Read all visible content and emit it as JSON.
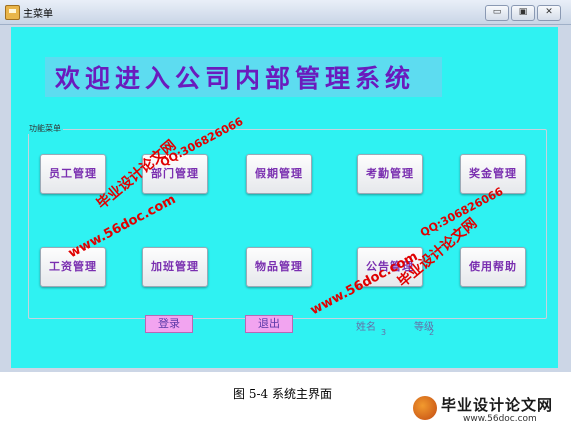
{
  "window": {
    "title": "主菜单",
    "minimize_glyph": "▭",
    "maximize_glyph": "▣",
    "close_glyph": "✕"
  },
  "banner": {
    "text": "欢迎进入公司内部管理系统"
  },
  "menu": {
    "group_label": "功能菜单",
    "buttons": [
      "员工管理",
      "部门管理",
      "假期管理",
      "考勤管理",
      "奖金管理",
      "工资管理",
      "加班管理",
      "物品管理",
      "公告管理",
      "使用帮助"
    ]
  },
  "footer": {
    "login_label": "登录",
    "logout_label": "退出",
    "name_label": "姓名",
    "name_value": "3",
    "level_label": "等级",
    "level_value": "2"
  },
  "watermarks": {
    "site": "www.56doc.com",
    "brand": "毕业设计论文网",
    "qq": "QQ:306826066"
  },
  "caption": "图 5-4  系统主界面",
  "logo": {
    "main": "毕业设计论文网",
    "sub": "www.56doc.com"
  }
}
